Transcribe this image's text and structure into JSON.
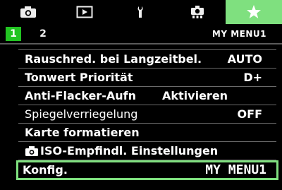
{
  "tabs": [
    {
      "icon": "camera-icon",
      "active": false
    },
    {
      "icon": "playback-icon",
      "active": false
    },
    {
      "icon": "wrench-icon",
      "active": false
    },
    {
      "icon": "custom-function-camera-icon",
      "active": false
    },
    {
      "icon": "star-icon",
      "active": true
    }
  ],
  "subtabs": {
    "items": [
      "1",
      "2"
    ],
    "active_index": 0
  },
  "header": {
    "title": "MY MENU1"
  },
  "menu": {
    "items": [
      {
        "label": "Rauschred. bei Langzeitbel.",
        "value": "AUTO"
      },
      {
        "label": "Tonwert Priorität",
        "value": "D+"
      },
      {
        "label": "Anti-Flacker-Aufn",
        "value": "Aktivieren"
      },
      {
        "label": "Spiegelverriegelung",
        "value": "OFF"
      },
      {
        "label": "Karte formatieren",
        "value": ""
      },
      {
        "label": "ISO-Empfindl. Einstellungen",
        "value": "",
        "icon": "camera-icon"
      },
      {
        "label": "Konfig.",
        "value": "MY MENU1",
        "selected": true
      }
    ]
  },
  "colors": {
    "accent": "#7fe07f",
    "active_subtab": "#22c422",
    "background": "#000000"
  }
}
